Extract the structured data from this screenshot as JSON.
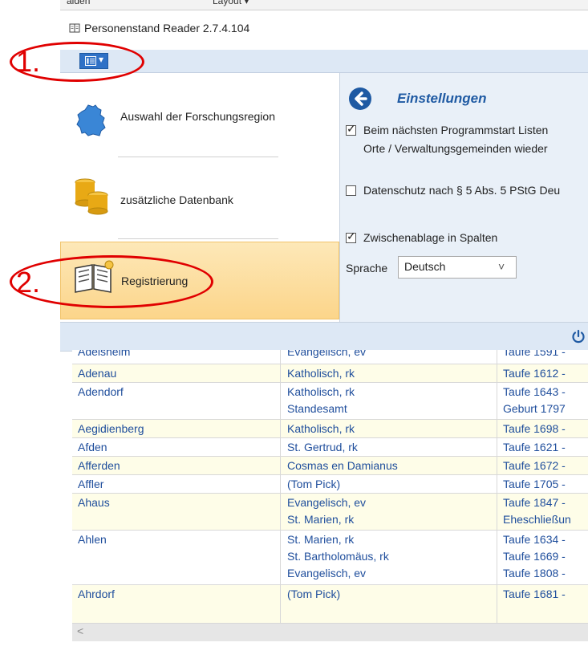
{
  "top_strip": {
    "left_fragment": "aiden",
    "layout_label": "Layout ▾"
  },
  "window": {
    "title": "Personenstand Reader 2.7.4.104"
  },
  "ribbon": {
    "menu_button_arrow": "▾"
  },
  "backstage": {
    "items": [
      {
        "label": "Auswahl der Forschungsregion",
        "icon": "germany-map-icon"
      },
      {
        "label": "zusätzliche Datenbank",
        "icon": "coins-database-icon"
      },
      {
        "label": "Registrierung",
        "icon": "book-key-icon",
        "selected": true
      }
    ]
  },
  "settings": {
    "title": "Einstellungen",
    "options": [
      {
        "checked": true,
        "line1": "Beim nächsten Programmstart Listen",
        "line2": "Orte / Verwaltungsgemeinden wieder"
      },
      {
        "checked": false,
        "line1": "Datenschutz nach § 5 Abs. 5 PStG Deu"
      },
      {
        "checked": true,
        "line1": "Zwischenablage in Spalten"
      }
    ],
    "language_label": "Sprache",
    "language_value": "Deutsch",
    "check_glyph": "✓",
    "dropdown_glyph": "˅"
  },
  "table": {
    "rows": [
      {
        "place": "Adelsheim",
        "parish": [
          "Evangelisch, ev"
        ],
        "records": [
          "Taufe 1591 -"
        ]
      },
      {
        "place": "Adenau",
        "parish": [
          "Katholisch, rk"
        ],
        "records": [
          "Taufe 1612 -"
        ]
      },
      {
        "place": "Adendorf",
        "parish": [
          "Katholisch, rk",
          "Standesamt"
        ],
        "records": [
          "Taufe 1643 -",
          "Geburt 1797"
        ]
      },
      {
        "place": "Aegidienberg",
        "parish": [
          "Katholisch, rk"
        ],
        "records": [
          "Taufe 1698 -"
        ]
      },
      {
        "place": "Afden",
        "parish": [
          "St. Gertrud, rk"
        ],
        "records": [
          "Taufe 1621 -"
        ]
      },
      {
        "place": "Afferden",
        "parish": [
          "Cosmas en Damianus"
        ],
        "records": [
          "Taufe 1672 -"
        ]
      },
      {
        "place": "Affler",
        "parish": [
          "(Tom Pick)"
        ],
        "records": [
          "Taufe 1705 -"
        ]
      },
      {
        "place": "Ahaus",
        "parish": [
          "Evangelisch, ev",
          "St. Marien, rk"
        ],
        "records": [
          "Taufe 1847 -",
          "Eheschließun"
        ]
      },
      {
        "place": "Ahlen",
        "parish": [
          "St. Marien, rk",
          "St. Bartholomäus, rk",
          "Evangelisch, ev"
        ],
        "records": [
          "Taufe 1634 -",
          "Taufe 1669 -",
          "Taufe 1808 -"
        ]
      },
      {
        "place": "Ahrdorf",
        "parish": [
          "(Tom Pick)"
        ],
        "records": [
          "Taufe 1681 -"
        ]
      }
    ]
  },
  "scrollbar": {
    "left_arrow": "<"
  },
  "annotations": [
    {
      "label": "1."
    },
    {
      "label": "2."
    }
  ],
  "colors": {
    "annotation": "#e00000",
    "accent_blue": "#2f71c6",
    "selected_gradient_top": "#fde8b8",
    "selected_gradient_bottom": "#fcd58a",
    "table_link": "#1f4e9c",
    "row_alt": "#fefde8"
  }
}
